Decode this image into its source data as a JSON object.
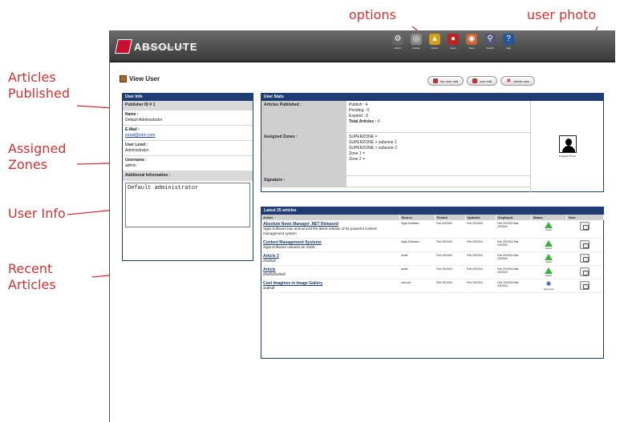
{
  "callouts": {
    "options": "options",
    "user_photo": "user photo",
    "articles_published": [
      "Articles",
      "Published"
    ],
    "assigned_zones": [
      "Assigned",
      "Zones"
    ],
    "user_info": "User Info",
    "recent_articles": [
      "Recent",
      "Articles"
    ]
  },
  "colors": {
    "callout": "#cc3333",
    "panel_header": "#1d3d73",
    "status_ok": "#3bb33b"
  },
  "app": {
    "logo": "ABSOLUTE",
    "logo_sub": "NewsManager.NET",
    "toolbar": [
      {
        "icon": "tools-icon",
        "label": "Admin",
        "color": "#666"
      },
      {
        "icon": "disk-icon",
        "label": "Articles",
        "color": "#888"
      },
      {
        "icon": "zone-icon",
        "label": "Zones",
        "color": "#d4a017"
      },
      {
        "icon": "user-icon",
        "label": "Users",
        "color": "#b22"
      },
      {
        "icon": "globe-icon",
        "label": "Sites",
        "color": "#c63"
      },
      {
        "icon": "search-icon",
        "label": "Search",
        "color": "#557"
      },
      {
        "icon": "help-icon",
        "label": "Help",
        "color": "#259"
      }
    ],
    "page_title": "View User",
    "actions": [
      "the user edit",
      "user edit",
      "delete user"
    ]
  },
  "user_info": {
    "header": "User Info",
    "publisher_id": "Publisher ID # 1",
    "name_label": "Name :",
    "name": "Default Administrator",
    "email_label": "E-Mail :",
    "email": "email@xnm.com",
    "user_level_label": "User Level :",
    "user_level": "Administrator",
    "username_label": "Username :",
    "username": "admin",
    "notes_label": "Additional Information :",
    "notes": "Default administrator"
  },
  "user_stats": {
    "header": "User Stats",
    "published_label": "Articles Published :",
    "published": [
      "Publish : 4",
      "Pending : 0",
      "Expired : 0"
    ],
    "total_label": "Total Articles :",
    "total": "4",
    "zones_label": "Assigned Zones :",
    "zones": [
      "SUPERZONE =",
      "SUPERZONE > subzone 1",
      "SUPERZONE > subzone 2",
      "Zone 1 =",
      "Zone 2 ="
    ],
    "signature_label": "Signature :",
    "photo_caption": "Publisher Photo"
  },
  "articles": {
    "header": "Latest 25 articles",
    "columns": [
      "Article",
      "Source",
      "Posted",
      "Updated",
      "Displayed",
      "Status",
      "View"
    ],
    "rows": [
      {
        "title": "Absolute News Manager .NET Released",
        "desc": "Xigla Software has announced the latest release of its powerful content management system",
        "source": "Xigla Software",
        "posted": "Feb 29/2004",
        "updated": "Feb 29/2004",
        "displayed": "Feb 29/2004 Mar 29/2004",
        "status": "Active",
        "status_type": "ok"
      },
      {
        "title": "Content Management Systems",
        "desc": "Xigla Software unleash an ICMS",
        "source": "Xigla Software",
        "posted": "Feb 29/2004",
        "updated": "Feb 29/2004",
        "displayed": "Feb 29/2004 Mar 29/2004",
        "status": "Active",
        "status_type": "ok"
      },
      {
        "title": "Article 2",
        "desc": "dfsdfsdf",
        "source": "asdfs",
        "posted": "Feb 29/2004",
        "updated": "Feb 29/2004",
        "displayed": "Feb 29/2004 Mar 29/2004",
        "status": "Active",
        "status_type": "ok"
      },
      {
        "title": "Article",
        "desc": "dfsdfsdfsdfsdf",
        "source": "asdfs",
        "posted": "Feb 29/2004",
        "updated": "Feb 29/2004",
        "displayed": "Feb 29/2004 Mar 29/2004",
        "status": "Active",
        "status_type": "ok"
      },
      {
        "title": "Cool Imagines in Image Gallery",
        "desc": "asdfsdf",
        "source": "xxm.net",
        "posted": "Feb 29/2004",
        "updated": "Feb 29/2004",
        "displayed": "Feb 15/2004 Mar 25/2004",
        "status": "Approved",
        "status_type": "approved"
      }
    ]
  }
}
